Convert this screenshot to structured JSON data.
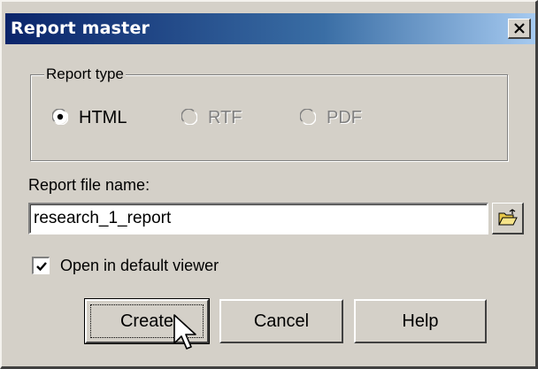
{
  "window": {
    "title": "Report master"
  },
  "report_type": {
    "label": "Report type",
    "options": [
      {
        "label": "HTML",
        "selected": true,
        "enabled": true
      },
      {
        "label": "RTF",
        "selected": false,
        "enabled": false
      },
      {
        "label": "PDF",
        "selected": false,
        "enabled": false
      }
    ]
  },
  "file": {
    "label": "Report file name:",
    "value": "research_1_report",
    "browse_icon": "folder-open-icon"
  },
  "open_viewer": {
    "label": "Open in default viewer",
    "checked": true
  },
  "buttons": {
    "create": "Create",
    "cancel": "Cancel",
    "help": "Help"
  },
  "colors": {
    "titlebar_start": "#0a246a",
    "titlebar_end": "#a6caf0",
    "dialog_bg": "#d4d0c8"
  }
}
